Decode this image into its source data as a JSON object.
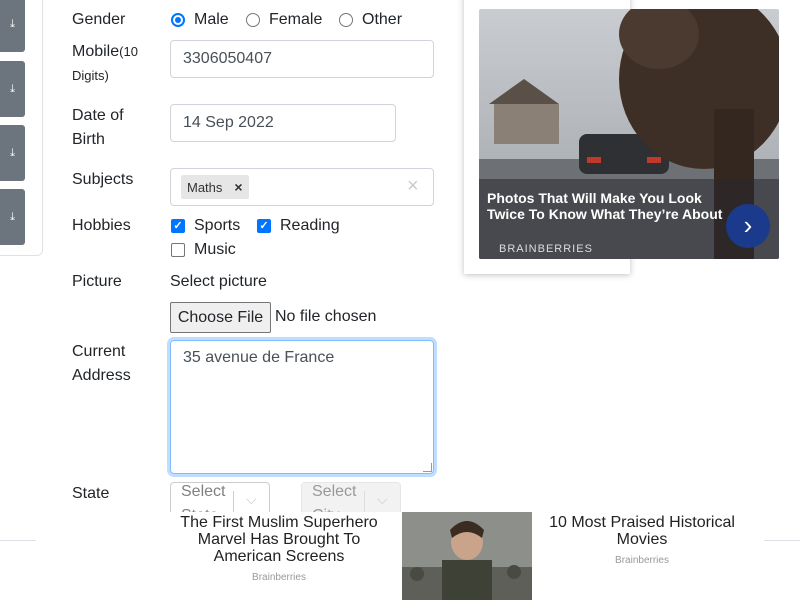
{
  "form": {
    "gender_label": "Gender",
    "gender_options": [
      "Male",
      "Female",
      "Other"
    ],
    "gender_selected": "Male",
    "mobile_label": "Mobile",
    "mobile_hint": "(10",
    "mobile_hint2": "Digits)",
    "mobile_value": "3306050407",
    "dob_label1": "Date of",
    "dob_label2": "Birth",
    "dob_value": "14 Sep 2022",
    "subjects_label": "Subjects",
    "subjects_chip": "Maths",
    "chip_remove": "×",
    "subjects_clear": "×",
    "hobbies_label": "Hobbies",
    "hobbies": [
      {
        "label": "Sports",
        "checked": true
      },
      {
        "label": "Reading",
        "checked": true
      },
      {
        "label": "Music",
        "checked": false
      }
    ],
    "picture_label": "Picture",
    "picture_sublabel": "Select picture",
    "file_button": "Choose File",
    "file_status": "No file chosen",
    "address_label1": "Current",
    "address_label2": "Address",
    "address_value": "35 avenue de France",
    "state_label": "State",
    "state_placeholder": "Select State",
    "city_placeholder": "Select City"
  },
  "ad_right": {
    "headline": "Photos That Will Make You Look Twice To Know What They’re About",
    "brand": "BRAINBERRIES",
    "next_icon": "chevron-right-icon"
  },
  "ad_bottom": {
    "left_title": "The First Muslim Superhero Marvel Has Brought To American Screens",
    "left_brand": "Brainberries",
    "right_title": "10 Most Praised Historical Movies",
    "right_brand": "Brainberries"
  },
  "colors": {
    "accent": "#0075ff",
    "sidebar": "#6c757d",
    "focus": "#80bdff"
  }
}
